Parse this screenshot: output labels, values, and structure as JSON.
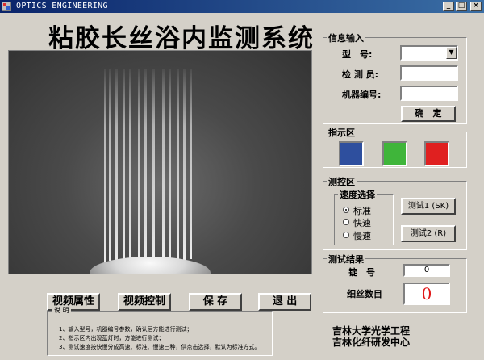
{
  "window": {
    "title": "OPTICS ENGINEERING",
    "minimize_glyph": "_",
    "maximize_glyph": "□",
    "close_glyph": "×"
  },
  "main_title": "粘胶长丝浴内监测系统",
  "buttons": {
    "video_props": "视频属性",
    "video_control": "视频控制",
    "save": "保 存",
    "exit": "退 出"
  },
  "instructions": {
    "legend": "说 明",
    "lines": [
      "1、输入型号，机器编号参数，确认后方能进行测试；",
      "2、指示区内出现蓝灯时，方能进行测试；",
      "3、测试速度按快慢分成高速、标准、慢速三种，供点击选择，默认为标准方式。"
    ]
  },
  "info_input": {
    "title": "信息输入",
    "model_label": "型　号:",
    "model_value": "",
    "inspector_label": "检 测 员:",
    "inspector_value": "",
    "machine_label": "机器编号:",
    "machine_value": "",
    "confirm_label": "确　定"
  },
  "indicator": {
    "title": "指示区",
    "colors": [
      "#2e4f9e",
      "#3fb53a",
      "#e02020"
    ]
  },
  "control": {
    "title": "测控区",
    "speed_title": "速度选择",
    "speeds": [
      {
        "label": "标准",
        "selected": true
      },
      {
        "label": "快速",
        "selected": false
      },
      {
        "label": "慢速",
        "selected": false
      }
    ],
    "test1_label": "测试1 (SK)",
    "test2_label": "测试2 (R)"
  },
  "results": {
    "title": "测试结果",
    "ingot_label": "锭　号",
    "ingot_value": "0",
    "fiber_label": "细丝数目",
    "fiber_value": "0"
  },
  "org": {
    "line1": "吉林大学光学工程",
    "line2": "吉林化纤研发中心"
  }
}
